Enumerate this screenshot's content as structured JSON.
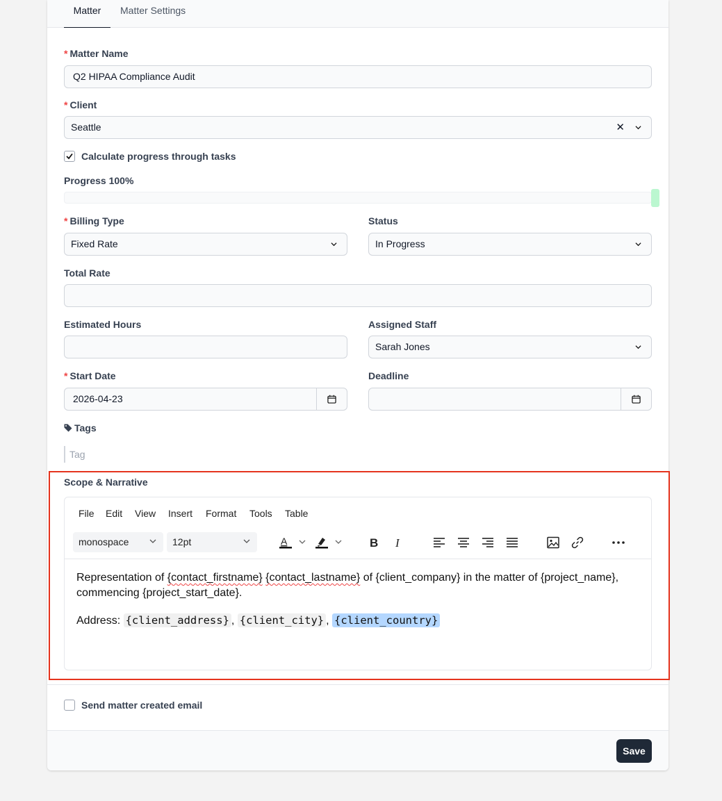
{
  "tabs": [
    {
      "label": "Matter"
    },
    {
      "label": "Matter Settings"
    }
  ],
  "form": {
    "matter_name": {
      "label": "Matter Name",
      "value": "Q2 HIPAA Compliance Audit"
    },
    "client": {
      "label": "Client",
      "value": "Seattle"
    },
    "calc_progress": {
      "label": "Calculate progress through tasks",
      "checked": true
    },
    "progress": {
      "label": "Progress 100%",
      "value": 1.0
    },
    "billing_type": {
      "label": "Billing Type",
      "value": "Fixed Rate"
    },
    "status": {
      "label": "Status",
      "value": "In Progress"
    },
    "total_rate": {
      "label": "Total Rate",
      "value": ""
    },
    "estimated_hours": {
      "label": "Estimated Hours",
      "value": ""
    },
    "assigned_staff": {
      "label": "Assigned Staff",
      "value": "Sarah Jones"
    },
    "start_date": {
      "label": "Start Date",
      "value": "2026-04-23"
    },
    "deadline": {
      "label": "Deadline",
      "value": ""
    },
    "tags": {
      "label": "Tags",
      "placeholder": "Tag"
    },
    "scope": {
      "label": "Scope & Narrative"
    },
    "send_email": {
      "label": "Send matter created email",
      "checked": false
    },
    "required_marker": "*"
  },
  "editor": {
    "menu": [
      "File",
      "Edit",
      "View",
      "Insert",
      "Format",
      "Tools",
      "Table"
    ],
    "font_family": "monospace",
    "font_size": "12pt",
    "content": {
      "p1_a": "Representation of ",
      "p1_var1": "{contact_firstname}",
      "p1_sp": " ",
      "p1_var2": "{contact_lastname}",
      "p1_b": " of {client_company} in the matter of {project_name}, commencing {project_start_date}.",
      "addr_label": "Address: ",
      "addr_var1": "{client_address}",
      "sep1": ", ",
      "addr_var2": "{client_city}",
      "sep2": ", ",
      "addr_var3": "{client_country}"
    }
  },
  "footer": {
    "save_label": "Save"
  },
  "colors": {
    "accent": "#1f2937",
    "required": "#ef4444",
    "progress": "#bbf7d0",
    "highlight_frame": "#e5331d",
    "selection": "#b4d7ff"
  }
}
